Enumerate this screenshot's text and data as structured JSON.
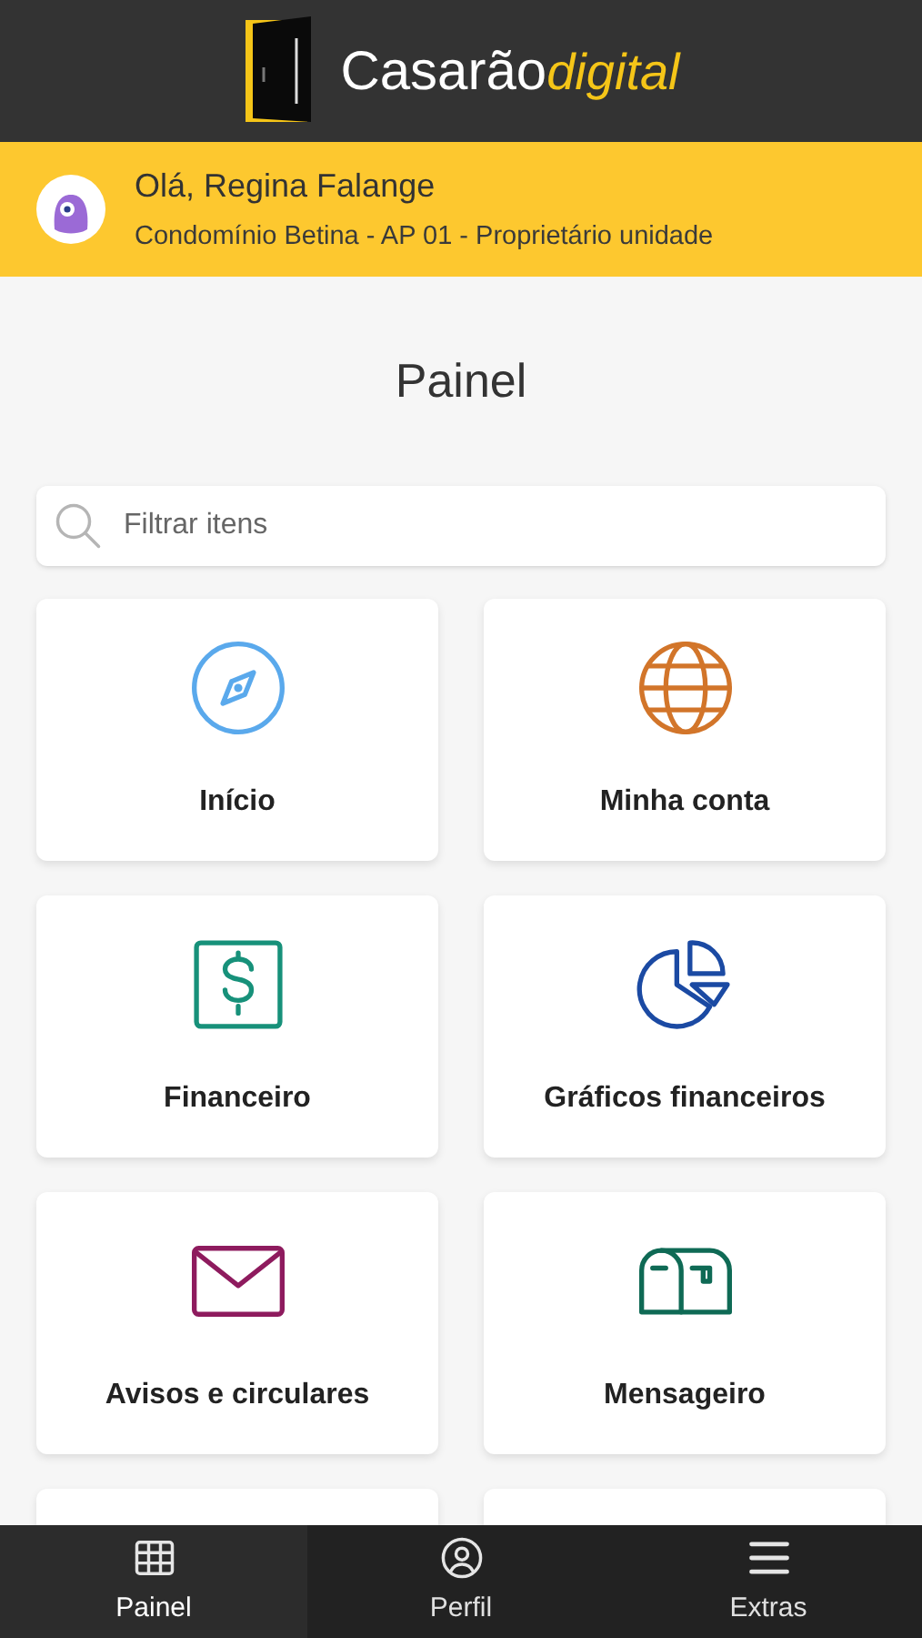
{
  "header": {
    "logo": {
      "name": "Casarão",
      "suffix": "digital"
    }
  },
  "user_bar": {
    "greeting": "Olá, Regina Falange",
    "subtitle": "Condomínio Betina - AP 01 - Proprietário unidade"
  },
  "page_title": "Painel",
  "search": {
    "placeholder": "Filtrar itens"
  },
  "cards": [
    {
      "label": "Início",
      "kind": "compass",
      "color": "#5aa9ec"
    },
    {
      "label": "Minha conta",
      "kind": "globe",
      "color": "#d2752a"
    },
    {
      "label": "Financeiro",
      "kind": "dollar",
      "color": "#17917a"
    },
    {
      "label": "Gráficos financeiros",
      "kind": "pie",
      "color": "#1b4aa3"
    },
    {
      "label": "Avisos e circulares",
      "kind": "mail",
      "color": "#8e1b5e"
    },
    {
      "label": "Mensageiro",
      "kind": "mailbox",
      "color": "#0f6a55"
    }
  ],
  "bottom_nav": [
    {
      "label": "Painel",
      "kind": "grid",
      "selected": true
    },
    {
      "label": "Perfil",
      "kind": "profile",
      "selected": false
    },
    {
      "label": "Extras",
      "kind": "menu",
      "selected": false
    }
  ]
}
